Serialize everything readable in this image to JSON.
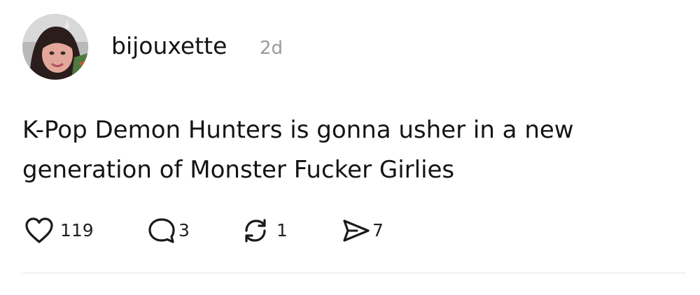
{
  "post": {
    "author": "bijouxette",
    "time": "2d",
    "text": "K-Pop Demon Hunters is gonna usher in a new generation of Monster Fucker Girlies"
  },
  "actions": {
    "likes": "119",
    "replies": "3",
    "reposts": "1",
    "shares": "7"
  },
  "icons": {
    "like": "heart-icon",
    "reply": "speech-bubble-icon",
    "repost": "repost-icon",
    "share": "send-icon"
  }
}
